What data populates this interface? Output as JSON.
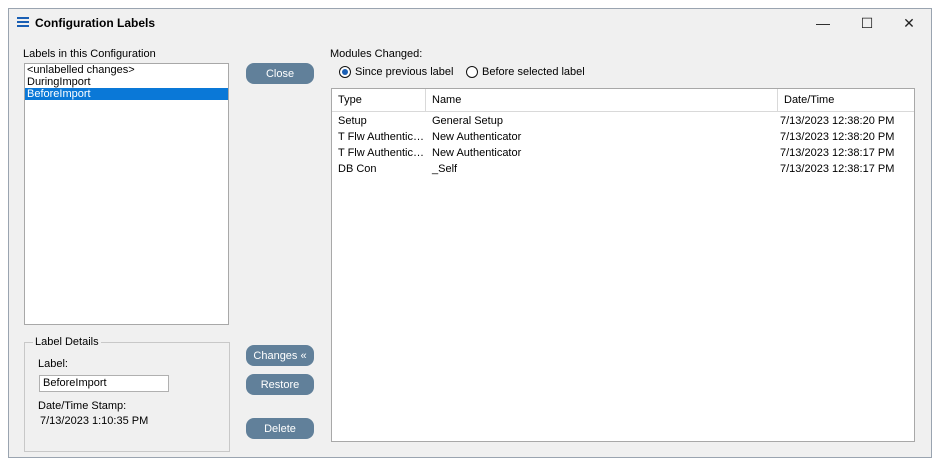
{
  "window": {
    "title": "Configuration Labels",
    "minimize": "—",
    "maximize": "☐",
    "close": "✕"
  },
  "labels_panel": {
    "heading": "Labels in this Configuration",
    "items": [
      "<unlabelled changes>",
      "DuringImport",
      "BeforeImport"
    ],
    "selected_index": 2
  },
  "label_details": {
    "legend": "Label Details",
    "label_caption": "Label:",
    "label_value": "BeforeImport",
    "timestamp_caption": "Date/Time Stamp:",
    "timestamp_value": "7/13/2023 1:10:35 PM"
  },
  "buttons": {
    "close": "Close",
    "changes": "Changes «",
    "restore": "Restore",
    "delete": "Delete"
  },
  "modules": {
    "heading": "Modules Changed:",
    "radio_since": "Since previous label",
    "radio_before": "Before selected label",
    "selected_radio": "since",
    "columns": [
      "Type",
      "Name",
      "Date/Time"
    ],
    "rows": [
      [
        "Setup",
        "General Setup",
        "7/13/2023 12:38:20 PM"
      ],
      [
        "T Flw Authenticator",
        "New Authenticator",
        "7/13/2023 12:38:20 PM"
      ],
      [
        "T Flw Authenticator",
        "New Authenticator",
        "7/13/2023 12:38:17 PM"
      ],
      [
        "DB Con",
        "_Self",
        "7/13/2023 12:38:17 PM"
      ]
    ]
  },
  "colors": {
    "button_bg": "#61809a",
    "selection": "#0a78d7",
    "radio_dot": "#1a5fb4"
  }
}
